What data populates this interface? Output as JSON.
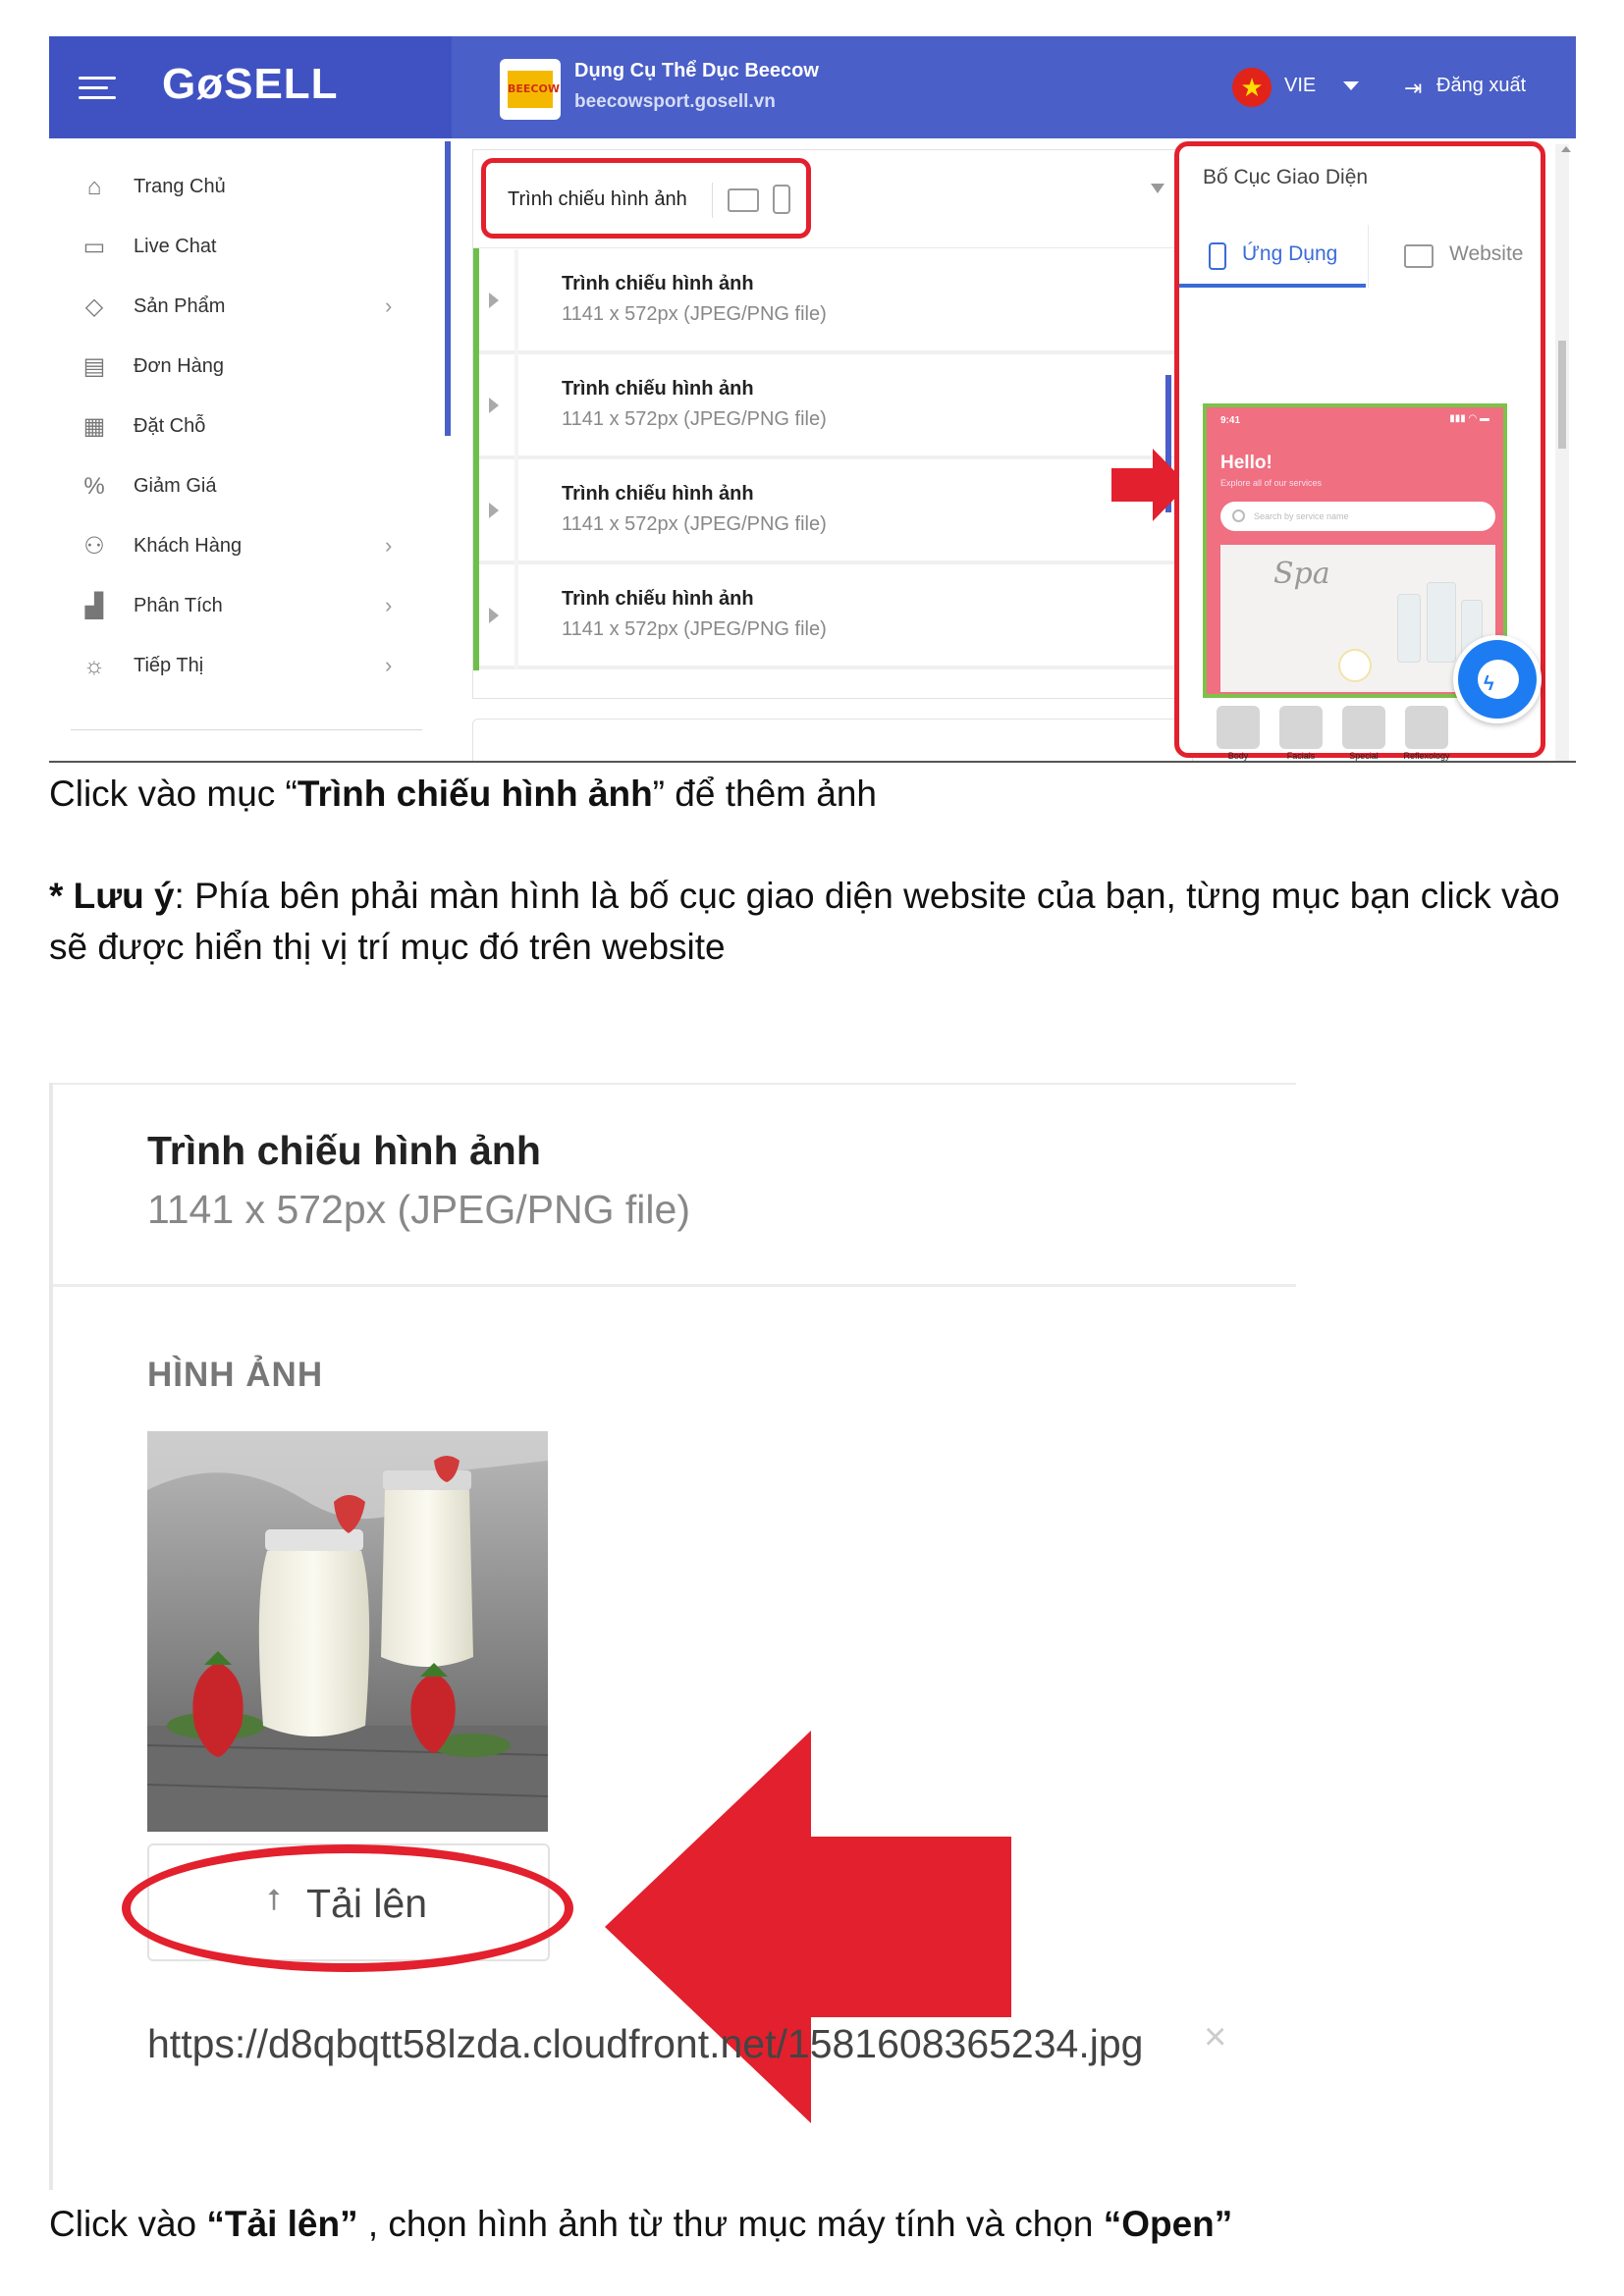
{
  "screenshot1": {
    "logo": "GøSELL",
    "store": {
      "thumb_text": "BEECOW",
      "name": "Dụng Cụ Thể Dục Beecow",
      "url": "beecowsport.gosell.vn"
    },
    "language": "VIE",
    "logout_label": "Đăng xuất",
    "sidebar": {
      "items": [
        {
          "label": "Trang Chủ",
          "icon": "home-icon",
          "has_children": false
        },
        {
          "label": "Live Chat",
          "icon": "chat-icon",
          "has_children": false
        },
        {
          "label": "Sản Phẩm",
          "icon": "tag-icon",
          "has_children": true
        },
        {
          "label": "Đơn Hàng",
          "icon": "receipt-icon",
          "has_children": false
        },
        {
          "label": "Đặt Chỗ",
          "icon": "calendar-icon",
          "has_children": false
        },
        {
          "label": "Giảm Giá",
          "icon": "discount-icon",
          "has_children": false
        },
        {
          "label": "Khách Hàng",
          "icon": "users-icon",
          "has_children": true
        },
        {
          "label": "Phân Tích",
          "icon": "chart-icon",
          "has_children": true
        },
        {
          "label": "Tiếp Thị",
          "icon": "lightbulb-icon",
          "has_children": true
        }
      ]
    },
    "section": {
      "header_title": "Trình chiếu hình ảnh",
      "rows": [
        {
          "title": "Trình chiếu hình ảnh",
          "subtitle": "1141 x 572px (JPEG/PNG file)"
        },
        {
          "title": "Trình chiếu hình ảnh",
          "subtitle": "1141 x 572px (JPEG/PNG file)"
        },
        {
          "title": "Trình chiếu hình ảnh",
          "subtitle": "1141 x 572px (JPEG/PNG file)"
        },
        {
          "title": "Trình chiếu hình ảnh",
          "subtitle": "1141 x 572px (JPEG/PNG file)"
        }
      ]
    },
    "layout_panel": {
      "title": "Bố Cục Giao Diện",
      "tab_app": "Ứng Dụng",
      "tab_web": "Website",
      "preview": {
        "time": "9:41",
        "hello": "Hello!",
        "subtitle": "Explore all of our services",
        "search_placeholder": "Search by service name",
        "banner_text": "Spa",
        "categories": [
          "Body Treatment",
          "Facials",
          "Special Massage",
          "Reflexology"
        ]
      }
    }
  },
  "caption1": {
    "prefix": "Click vào mục “",
    "bold": "Trình chiếu hình ảnh",
    "suffix": "”  để thêm ảnh"
  },
  "note": {
    "bold": "* Lưu ý",
    "text": ": Phía bên phải màn hình là bố cục giao diện website của bạn, từng mục bạn click vào sẽ được hiển thị vị trí mục đó trên website"
  },
  "screenshot2": {
    "title": "Trình chiếu hình ảnh",
    "subtitle": "1141 x 572px (JPEG/PNG file)",
    "images_label": "HÌNH ẢNH",
    "upload_label": "Tải lên",
    "url": "https://d8qbqtt58lzda.cloudfront.net/1581608365234.jpg",
    "remove_symbol": "×"
  },
  "caption2": {
    "prefix": "Click vào ",
    "bold1": "“Tải lên”",
    "middle": " , chọn hình ảnh từ thư mục máy tính và chọn ",
    "bold2": "“Open”"
  },
  "colors": {
    "brand": "#4a5fc7",
    "highlight_red": "#e3202d",
    "active_tab": "#3a6cd8",
    "preview_pink": "#f06f80",
    "section_green": "#6cc04a"
  }
}
